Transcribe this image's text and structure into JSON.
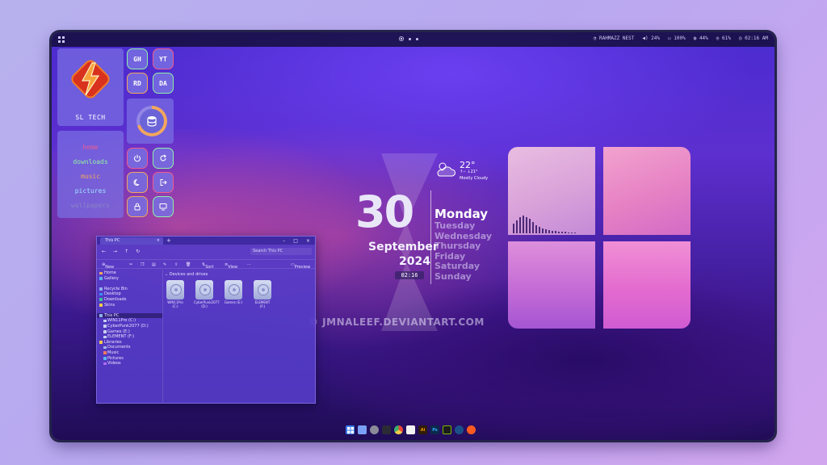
{
  "topbar": {
    "wifi": "RAHMAZZ NEST",
    "volume": "24%",
    "battery": "100%",
    "cpu": "44%",
    "ram": "61%",
    "time": "02:16 AM"
  },
  "sidebar": {
    "logo_title": "SL TECH",
    "quick_buttons": [
      "GH",
      "YT",
      "RD",
      "DA"
    ],
    "links": [
      {
        "label": "home",
        "color": "#f05b8c"
      },
      {
        "label": "downloads",
        "color": "#8ff0a8"
      },
      {
        "label": "music",
        "color": "#f2a65e"
      },
      {
        "label": "pictures",
        "color": "#9ee3ff"
      },
      {
        "label": "wallpapers",
        "color": "#8a83c8"
      }
    ],
    "power_buttons": [
      {
        "icon": "power-icon",
        "color": "#f05b8c"
      },
      {
        "icon": "refresh-icon",
        "color": "#8ff0a8"
      },
      {
        "icon": "moon-icon",
        "color": "#f2a65e"
      },
      {
        "icon": "logout-icon",
        "color": "#f05b8c"
      },
      {
        "icon": "lock-icon",
        "color": "#f2a65e"
      },
      {
        "icon": "monitor-icon",
        "color": "#8ff0a8"
      }
    ],
    "storage_ring_fraction": 0.7
  },
  "clock": {
    "day": "30",
    "month": "September",
    "year": "2024",
    "time": "02:16",
    "today": "Monday",
    "weekdays": [
      "Tuesday",
      "Wednesday",
      "Thursday",
      "Friday",
      "Saturday",
      "Sunday"
    ]
  },
  "weather": {
    "temp": "22°",
    "range": "↑-- ↓21°",
    "condition": "Mostly Cloudy"
  },
  "watermark": "© JMNALEEF.DEVIANTART.COM",
  "explorer": {
    "tab_title": "This PC",
    "search_placeholder": "Search This PC",
    "toolbar": {
      "new": "New",
      "sort": "Sort",
      "view": "View",
      "preview": "Preview"
    },
    "sidebar": [
      {
        "label": "Home",
        "indent": false,
        "selected": false
      },
      {
        "label": "Gallery",
        "indent": false,
        "selected": false
      },
      {
        "label": "",
        "indent": false,
        "selected": false
      },
      {
        "label": "Recycle Bin",
        "indent": false,
        "selected": false
      },
      {
        "label": "Desktop",
        "indent": false,
        "selected": false
      },
      {
        "label": "Downloads",
        "indent": false,
        "selected": false
      },
      {
        "label": "Skins",
        "indent": false,
        "selected": false
      },
      {
        "label": "",
        "indent": false,
        "selected": false
      },
      {
        "label": "This PC",
        "indent": false,
        "selected": true
      },
      {
        "label": "WIN11Pro (C:)",
        "indent": true,
        "selected": false
      },
      {
        "label": "CyberPunk2077 (D:)",
        "indent": true,
        "selected": false
      },
      {
        "label": "Games (E:)",
        "indent": true,
        "selected": false
      },
      {
        "label": "ELEMENT (F:)",
        "indent": true,
        "selected": false
      },
      {
        "label": "Libraries",
        "indent": false,
        "selected": false
      },
      {
        "label": "Documents",
        "indent": true,
        "selected": false
      },
      {
        "label": "Music",
        "indent": true,
        "selected": false
      },
      {
        "label": "Pictures",
        "indent": true,
        "selected": false
      },
      {
        "label": "Videos",
        "indent": true,
        "selected": false
      }
    ],
    "drives_heading": "Devices and drives",
    "drives": [
      {
        "line1": "WIN11Pro (C:)",
        "line2": ""
      },
      {
        "line1": "CyberPunk2077",
        "line2": "(D:)"
      },
      {
        "line1": "Games (E:)",
        "line2": ""
      },
      {
        "line1": "ELEMENT (F:)",
        "line2": ""
      }
    ]
  },
  "taskbar": [
    {
      "name": "start",
      "label": "",
      "color": "#3a7bf0"
    },
    {
      "name": "files",
      "label": "",
      "color": "#7aa0f5"
    },
    {
      "name": "settings",
      "label": "",
      "color": "#8a8a99"
    },
    {
      "name": "terminal",
      "label": "",
      "color": "#2b2b36"
    },
    {
      "name": "chrome",
      "label": "",
      "color": "#e8b93a"
    },
    {
      "name": "store",
      "label": "",
      "color": "#f2f2f2"
    },
    {
      "name": "illustrator",
      "label": "Ai",
      "color": "#2e1d06"
    },
    {
      "name": "photoshop",
      "label": "Ps",
      "color": "#0c2a4a"
    },
    {
      "name": "nvidia",
      "label": "",
      "color": "#1c1c1c"
    },
    {
      "name": "steam",
      "label": "",
      "color": "#1b4f8a"
    },
    {
      "name": "reddit",
      "label": "",
      "color": "#ff5a1f"
    }
  ]
}
